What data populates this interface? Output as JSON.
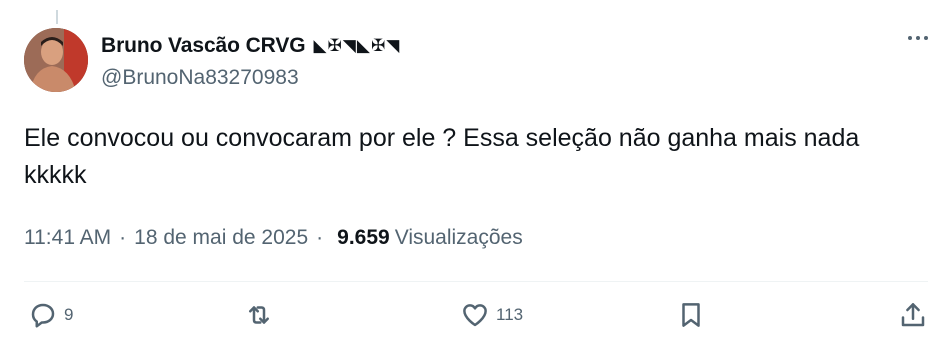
{
  "author": {
    "display_name": "Bruno Vascão CRVG",
    "name_emoji": "◣✠◥◣✠◥",
    "handle": "@BrunoNa83270983"
  },
  "tweet": {
    "text": "Ele convocou ou convocaram por ele ? Essa seleção não ganha mais nada kkkkk",
    "time": "11:41 AM",
    "date": "18 de mai de 2025",
    "separator": "·",
    "views_count": "9.659",
    "views_label": "Visualizações"
  },
  "actions": {
    "reply_count": "9",
    "like_count": "113"
  },
  "icons": [
    "more-icon",
    "reply-icon",
    "retweet-icon",
    "like-icon",
    "bookmark-icon",
    "share-icon"
  ]
}
